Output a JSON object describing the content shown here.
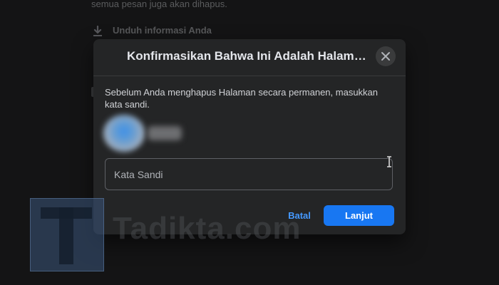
{
  "background": {
    "top_text": "semua pesan juga akan dihapus.",
    "download_label": "Unduh informasi Anda"
  },
  "modal": {
    "title": "Konfirmasikan Bahwa Ini Adalah Halaman A...",
    "description": "Sebelum Anda menghapus Halaman secara permanen, masukkan kata sandi.",
    "password_placeholder": "Kata Sandi",
    "password_value": "",
    "cancel_label": "Batal",
    "continue_label": "Lanjut"
  },
  "watermark": {
    "text": "Tadikta.com"
  },
  "icons": {
    "close": "close-icon",
    "download": "download-icon",
    "cursor": "text-cursor-icon"
  },
  "colors": {
    "modal_bg": "#242526",
    "primary": "#1877f2",
    "link": "#4599ff",
    "text": "#e4e6eb"
  }
}
